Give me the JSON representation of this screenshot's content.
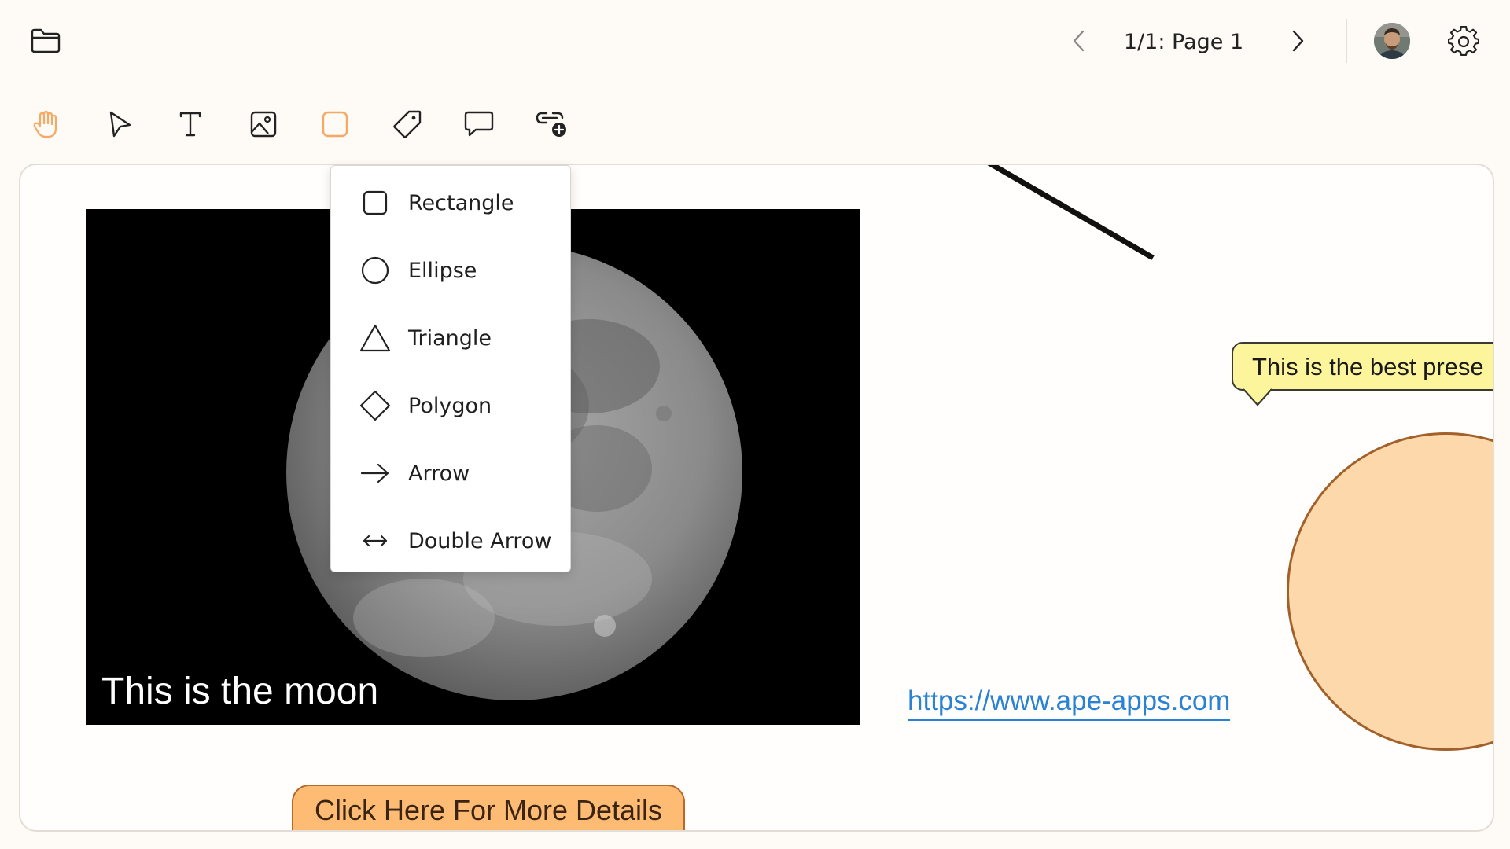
{
  "topbar": {
    "page_indicator": "1/1: Page 1",
    "icons": {
      "folder": "folder-icon",
      "prev": "chevron-left-icon",
      "next": "chevron-right-icon",
      "avatar": "avatar",
      "settings": "gear-icon"
    }
  },
  "toolbar": {
    "tools": [
      {
        "id": "hand",
        "icon": "hand-icon",
        "active": true
      },
      {
        "id": "select",
        "icon": "pointer-icon"
      },
      {
        "id": "text",
        "icon": "text-icon"
      },
      {
        "id": "image",
        "icon": "image-icon"
      },
      {
        "id": "shape",
        "icon": "square-icon",
        "active": true
      },
      {
        "id": "label",
        "icon": "tag-icon"
      },
      {
        "id": "comment",
        "icon": "speech-bubble-icon"
      },
      {
        "id": "link",
        "icon": "link-add-icon"
      }
    ],
    "accent_color": "#f5a962"
  },
  "shape_menu": {
    "items": [
      {
        "label": "Rectangle",
        "icon": "rectangle-icon"
      },
      {
        "label": "Ellipse",
        "icon": "ellipse-icon"
      },
      {
        "label": "Triangle",
        "icon": "triangle-icon"
      },
      {
        "label": "Polygon",
        "icon": "diamond-icon"
      },
      {
        "label": "Arrow",
        "icon": "arrow-right-icon"
      },
      {
        "label": "Double Arrow",
        "icon": "double-arrow-icon"
      }
    ]
  },
  "canvas": {
    "moon_caption": "This is the moon",
    "speech_bubble_text": "This is the best prese",
    "url": "https://www.ape-apps.com",
    "details_button": "Click Here For More Details",
    "colors": {
      "bubble_fill": "#fdf59c",
      "circle_fill": "#fdd8ab",
      "circle_stroke": "#a2612a",
      "button_fill": "#fdbb73",
      "link": "#2a82d4"
    }
  }
}
